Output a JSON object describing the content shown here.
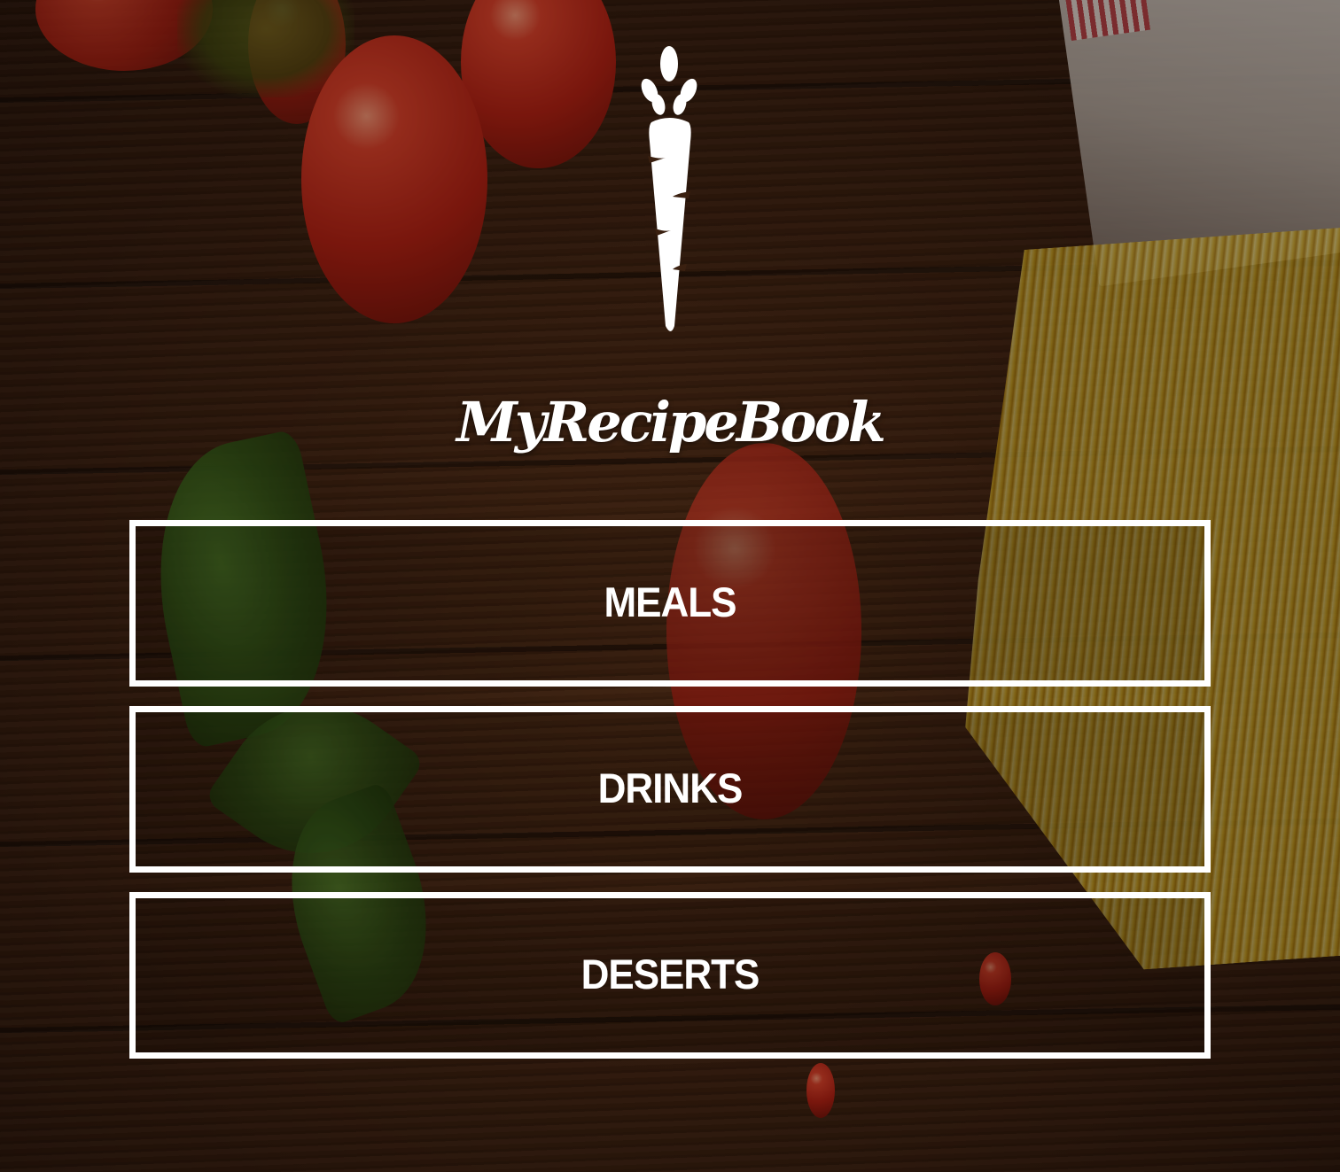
{
  "app": {
    "brand_name": "MyRecipeBook",
    "logo_icon": "carrot-icon"
  },
  "menu": {
    "items": [
      {
        "label": "MEALS"
      },
      {
        "label": "DRINKS"
      },
      {
        "label": "DESERTS"
      }
    ]
  },
  "colors": {
    "text": "#ffffff",
    "button_border": "#ffffff",
    "background": "#3e2210"
  }
}
